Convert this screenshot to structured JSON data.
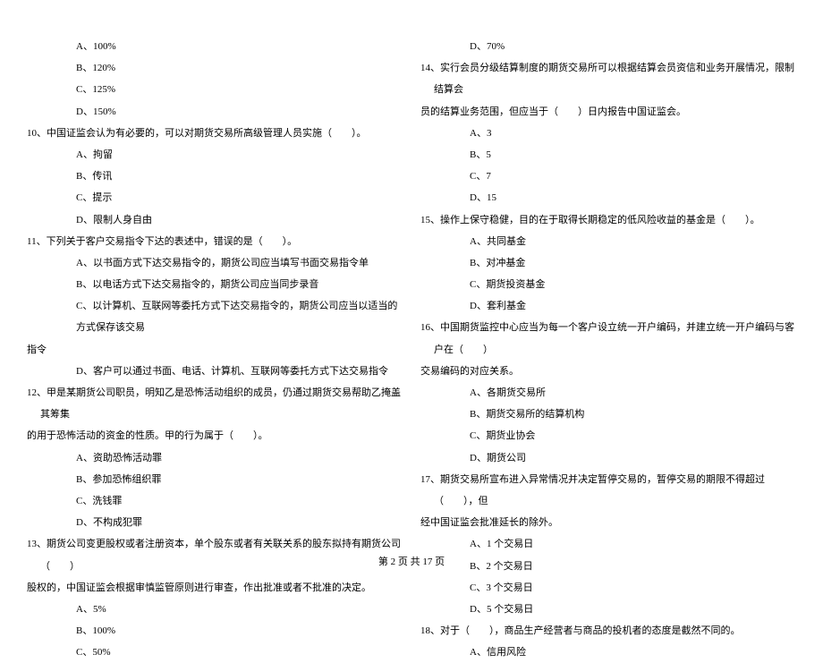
{
  "left_column": {
    "q9_opts": [
      "A、100%",
      "B、120%",
      "C、125%",
      "D、150%"
    ],
    "q10": "10、中国证监会认为有必要的，可以对期货交易所高级管理人员实施（　　）。",
    "q10_opts": [
      "A、拘留",
      "B、传讯",
      "C、提示",
      "D、限制人身自由"
    ],
    "q11": "11、下列关于客户交易指令下达的表述中，错误的是（　　）。",
    "q11_opts": [
      "A、以书面方式下达交易指令的，期货公司应当填写书面交易指令单",
      "B、以电话方式下达交易指令的，期货公司应当同步录音",
      "C、以计算机、互联网等委托方式下达交易指令的，期货公司应当以适当的方式保存该交易"
    ],
    "q11_cont": "指令",
    "q11_opt_d": "D、客户可以通过书面、电话、计算机、互联网等委托方式下达交易指令",
    "q12": "12、甲是某期货公司职员，明知乙是恐怖活动组织的成员，仍通过期货交易帮助乙掩盖其筹集",
    "q12_cont": "的用于恐怖活动的资金的性质。甲的行为属于（　　）。",
    "q12_opts": [
      "A、资助恐怖活动罪",
      "B、参加恐怖组织罪",
      "C、洗钱罪",
      "D、不构成犯罪"
    ],
    "q13": "13、期货公司变更股权或者注册资本，单个股东或者有关联关系的股东拟持有期货公司（　　）",
    "q13_cont": "股权的，中国证监会根据审慎监管原则进行审查，作出批准或者不批准的决定。",
    "q13_opts": [
      "A、5%",
      "B、100%",
      "C、50%"
    ]
  },
  "right_column": {
    "q13_opt_d": "D、70%",
    "q14": "14、实行会员分级结算制度的期货交易所可以根据结算会员资信和业务开展情况，限制结算会",
    "q14_cont": "员的结算业务范围，但应当于（　　）日内报告中国证监会。",
    "q14_opts": [
      "A、3",
      "B、5",
      "C、7",
      "D、15"
    ],
    "q15": "15、操作上保守稳健，目的在于取得长期稳定的低风险收益的基金是（　　）。",
    "q15_opts": [
      "A、共同基金",
      "B、对冲基金",
      "C、期货投资基金",
      "D、套利基金"
    ],
    "q16": "16、中国期货监控中心应当为每一个客户设立统一开户编码，并建立统一开户编码与客户在（　　）",
    "q16_cont": "交易编码的对应关系。",
    "q16_opts": [
      "A、各期货交易所",
      "B、期货交易所的结算机构",
      "C、期货业协会",
      "D、期货公司"
    ],
    "q17": "17、期货交易所宣布进入异常情况并决定暂停交易的，暂停交易的期限不得超过（　　），但",
    "q17_cont": "经中国证监会批准延长的除外。",
    "q17_opts": [
      "A、1 个交易日",
      "B、2 个交易日",
      "C、3 个交易日",
      "D、5 个交易日"
    ],
    "q18": "18、对于（　　），商品生产经营者与商品的投机者的态度是截然不同的。",
    "q18_opts": [
      "A、信用风险"
    ]
  },
  "footer": "第 2 页 共 17 页"
}
